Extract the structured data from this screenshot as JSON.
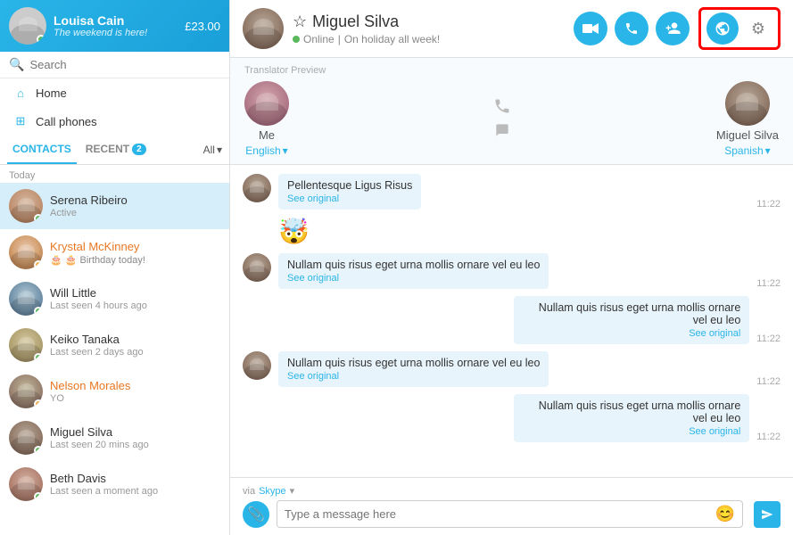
{
  "sidebar": {
    "user": {
      "name": "Louisa Cain",
      "status_text": "The weekend is here!",
      "balance": "£23.00",
      "avatar_class": "av-louisa"
    },
    "search": {
      "placeholder": "Search"
    },
    "nav": [
      {
        "id": "home",
        "label": "Home",
        "icon": "⌂"
      },
      {
        "id": "call-phones",
        "label": "Call phones",
        "icon": "⊞"
      }
    ],
    "tabs": [
      {
        "id": "contacts",
        "label": "CONTACTS",
        "active": true
      },
      {
        "id": "recent",
        "label": "RECENT",
        "badge": "2",
        "active": false
      }
    ],
    "filter_label": "All",
    "group_label": "Today",
    "contacts": [
      {
        "id": "serena",
        "name": "Serena Ribeiro",
        "subtext": "Active",
        "avatar_class": "av-serena",
        "dot": "green",
        "active": true,
        "name_color": "normal"
      },
      {
        "id": "krystal",
        "name": "Krystal McKinney",
        "subtext": "🎂 Birthday today!",
        "avatar_class": "av-krystal",
        "dot": "orange",
        "active": false,
        "name_color": "orange"
      },
      {
        "id": "will",
        "name": "Will Little",
        "subtext": "Last seen 4 hours ago",
        "avatar_class": "av-will",
        "dot": "green",
        "active": false,
        "name_color": "normal"
      },
      {
        "id": "keiko",
        "name": "Keiko Tanaka",
        "subtext": "Last seen 2 days ago",
        "avatar_class": "av-keiko",
        "dot": "green",
        "active": false,
        "name_color": "normal"
      },
      {
        "id": "nelson",
        "name": "Nelson Morales",
        "subtext": "YO",
        "avatar_class": "av-nelson",
        "dot": "orange",
        "active": false,
        "name_color": "orange"
      },
      {
        "id": "miguel",
        "name": "Miguel Silva",
        "subtext": "Last seen 20 mins ago",
        "avatar_class": "av-miguel",
        "dot": "green",
        "active": false,
        "name_color": "normal"
      },
      {
        "id": "beth",
        "name": "Beth Davis",
        "subtext": "Last seen a moment ago",
        "avatar_class": "av-beth",
        "dot": "green",
        "active": false,
        "name_color": "normal"
      }
    ]
  },
  "topbar": {
    "name": "Miguel Silva",
    "status": "Online",
    "status_extra": "On holiday all week!",
    "avatar_class": "av-miguel",
    "buttons": [
      {
        "id": "video-call",
        "icon": "📹",
        "label": "Video call"
      },
      {
        "id": "audio-call",
        "icon": "📞",
        "label": "Audio call"
      },
      {
        "id": "add-contact",
        "icon": "👤+",
        "label": "Add contact"
      }
    ]
  },
  "translator": {
    "label": "Translator Preview",
    "me": {
      "name": "Me",
      "lang": "English",
      "avatar_class": "av-me"
    },
    "other": {
      "name": "Miguel Silva",
      "lang": "Spanish",
      "avatar_class": "av-miguel"
    }
  },
  "messages": [
    {
      "id": 1,
      "sender": "other",
      "text": "Pellentesque Ligus Risus",
      "see_original": "See original",
      "time": "11:22",
      "avatar_class": "av-miguel"
    },
    {
      "id": 2,
      "sender": "emoji",
      "text": "🤯"
    },
    {
      "id": 3,
      "sender": "other",
      "text": "Nullam quis risus eget urna mollis ornare vel eu leo",
      "see_original": "See original",
      "time": "11:22",
      "avatar_class": "av-miguel"
    },
    {
      "id": 4,
      "sender": "me",
      "text": "Nullam quis risus eget urna mollis ornare vel eu leo",
      "see_original": "See original",
      "time": "11:22"
    },
    {
      "id": 5,
      "sender": "other",
      "text": "Nullam quis risus eget urna mollis ornare vel eu leo",
      "see_original": "See original",
      "time": "11:22",
      "avatar_class": "av-miguel"
    },
    {
      "id": 6,
      "sender": "me",
      "text": "Nullam quis risus eget urna mollis ornare vel eu leo",
      "see_original": "See original",
      "time": "11:22"
    }
  ],
  "input": {
    "via_label": "via",
    "via_skype": "Skype",
    "placeholder": "Type a message here"
  },
  "icons": {
    "star": "☆",
    "chevron_down": "▾",
    "search": "🔍",
    "home": "⌂",
    "grid": "⊞",
    "phone": "📞",
    "video": "📹",
    "add_person": "👤",
    "attach": "📎",
    "emoji": "😊",
    "send": "▶",
    "translator": "🌐",
    "settings": "⚙"
  }
}
